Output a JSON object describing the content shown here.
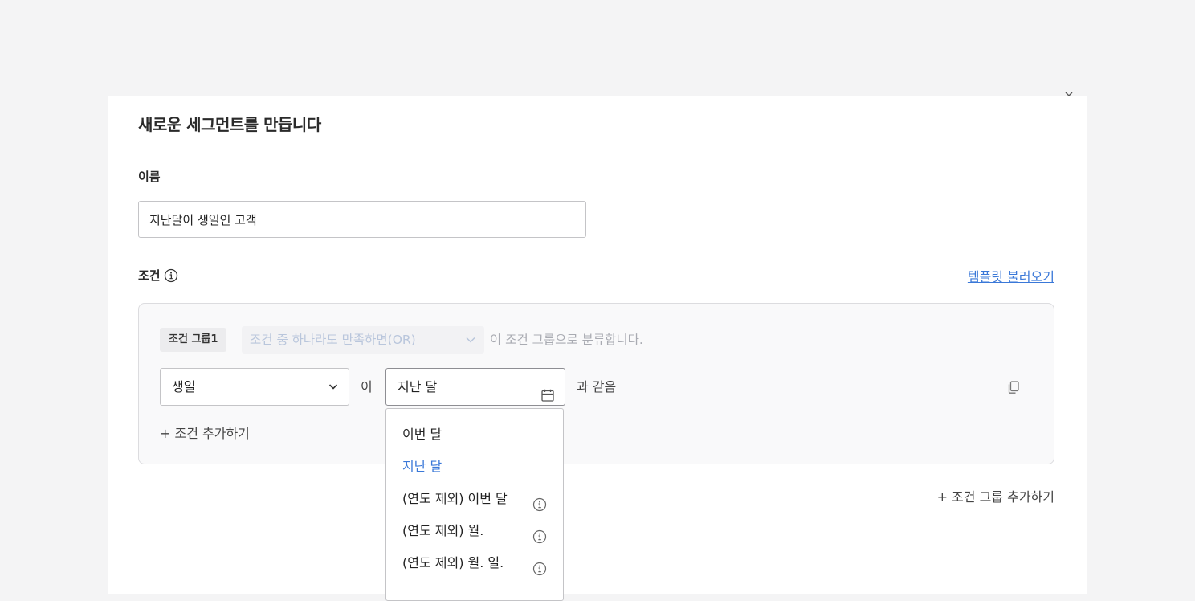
{
  "modal": {
    "title": "새로운 세그먼트를 만듭니다",
    "close_icon": "close-icon"
  },
  "name_field": {
    "label": "이름",
    "value": "지난달이 생일인 고객"
  },
  "conditions": {
    "label": "조건",
    "info_icon": "info-icon",
    "template_link": "템플릿 불러오기"
  },
  "group": {
    "tag": "조건 그룹1",
    "logic_value": "조건 중 하나라도 만족하면(OR)",
    "logic_suffix": "이 조건 그룹으로 분류합니다.",
    "rule": {
      "field": "생일",
      "operator": "이",
      "date_value": "지난 달",
      "comparator": "과 같음"
    },
    "add_condition": "+ 조건 추가하기"
  },
  "add_group": "+ 조건 그룹 추가하기",
  "dropdown": {
    "items": [
      {
        "label": "이번 달",
        "selected": false,
        "info": false
      },
      {
        "label": "지난 달",
        "selected": true,
        "info": false
      },
      {
        "label": "(연도 제외) 이번 달",
        "selected": false,
        "info": true
      },
      {
        "label": "(연도 제외) 월.",
        "selected": false,
        "info": true
      },
      {
        "label": "(연도 제외) 월. 일.",
        "selected": false,
        "info": true
      }
    ]
  },
  "colors": {
    "accent": "#3a78d8",
    "background": "#f4f4f5",
    "placeholder": "#b9c6dc"
  }
}
